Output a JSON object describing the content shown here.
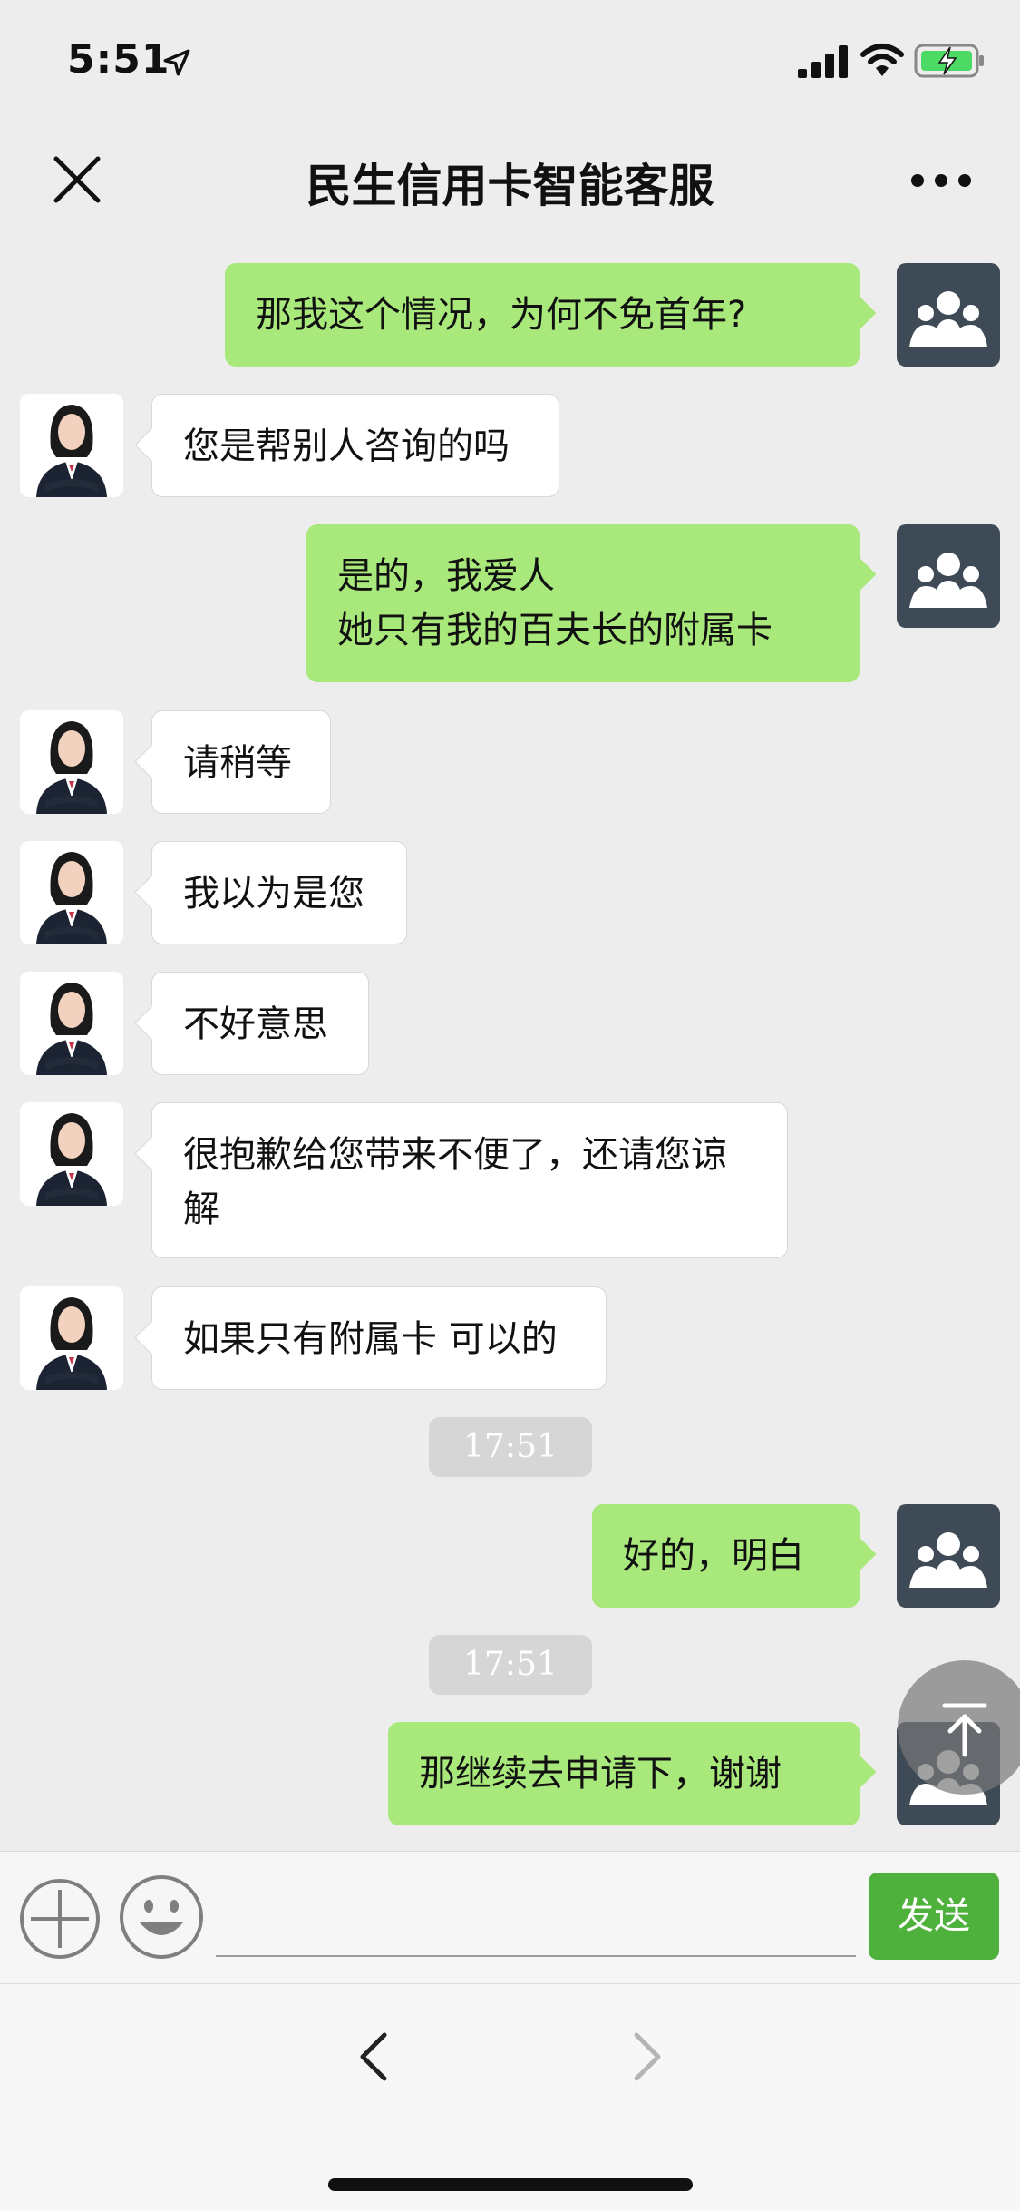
{
  "status_bar": {
    "time": "5:51"
  },
  "nav": {
    "title": "民生信用卡智能客服"
  },
  "messages": [
    {
      "side": "right",
      "text": "那我这个情况，为何不免首年?"
    },
    {
      "side": "left",
      "text": "您是帮别人咨询的吗"
    },
    {
      "side": "right",
      "text": "是的，我爱人\n她只有我的百夫长的附属卡"
    },
    {
      "side": "left",
      "text": "请稍等"
    },
    {
      "side": "left",
      "text": "我以为是您"
    },
    {
      "side": "left",
      "text": "不好意思"
    },
    {
      "side": "left",
      "text": "很抱歉给您带来不便了，还请您谅\n解"
    },
    {
      "side": "left",
      "text": "如果只有附属卡 可以的"
    },
    {
      "type": "timestamp",
      "text": "17:51"
    },
    {
      "side": "right",
      "text": "好的，明白"
    },
    {
      "type": "timestamp",
      "text": "17:51"
    },
    {
      "side": "right",
      "text": "那继续去申请下，谢谢"
    }
  ],
  "input_bar": {
    "send_label": "发送",
    "text_value": ""
  },
  "colors": {
    "user_bubble": "#a9e97b",
    "send_button": "#4eb13c",
    "background": "#ededed"
  },
  "icons": [
    "location-arrow-icon",
    "signal-icon",
    "wifi-icon",
    "battery-charging-icon",
    "close-icon",
    "more-icon",
    "plus-icon",
    "emoji-icon",
    "scroll-top-icon",
    "back-icon",
    "forward-icon"
  ]
}
